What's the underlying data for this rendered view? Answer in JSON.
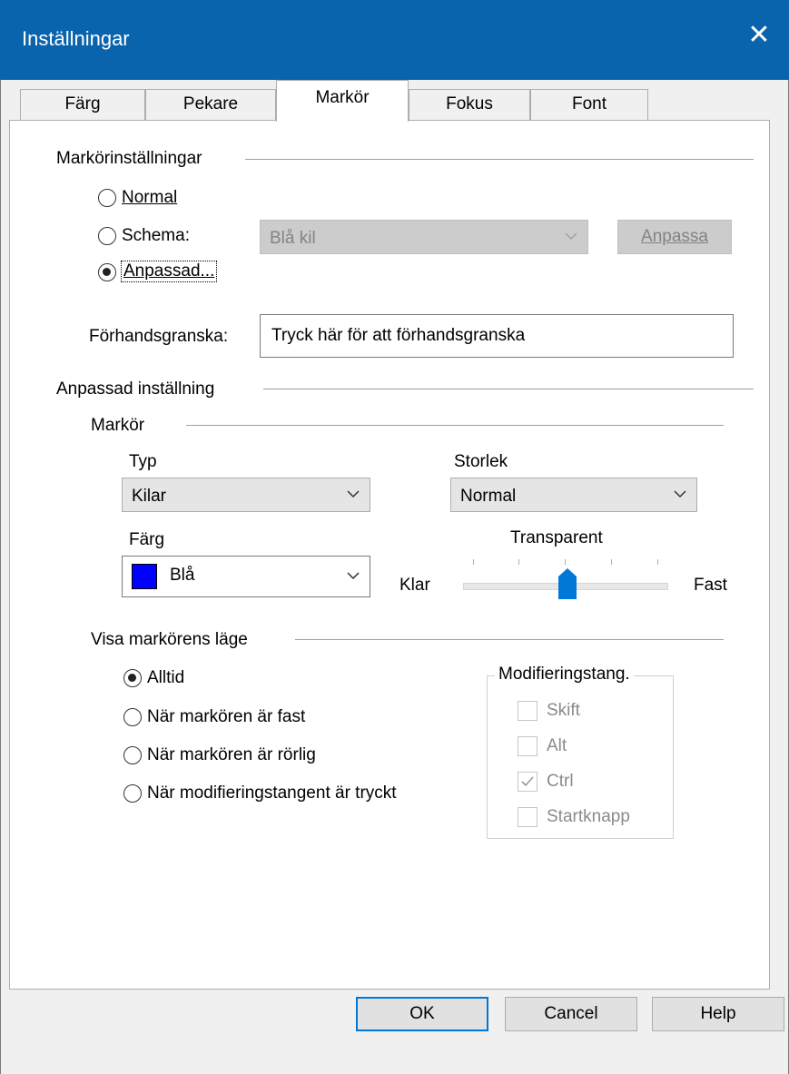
{
  "window": {
    "title": "Inställningar",
    "close_glyph": "✕",
    "titlebar_color": "#0a64ad"
  },
  "tabs": [
    {
      "label": "Färg",
      "active": false
    },
    {
      "label": "Pekare",
      "active": false
    },
    {
      "label": "Markör",
      "active": true
    },
    {
      "label": "Fokus",
      "active": false
    },
    {
      "label": "Font",
      "active": false
    }
  ],
  "cursor_settings": {
    "heading": "Markörinställningar",
    "options": [
      {
        "label": "Normal",
        "checked": false
      },
      {
        "label": "Schema:",
        "checked": false
      },
      {
        "label": "Anpassad...",
        "checked": true
      }
    ],
    "scheme_select": {
      "value": "Blå kil",
      "disabled": true
    },
    "customize_button": {
      "label": "Anpassa",
      "disabled": true
    }
  },
  "preview": {
    "label": "Förhandsgranska:",
    "value": "Tryck här för att förhandsgranska"
  },
  "custom_setting": {
    "heading": "Anpassad inställning",
    "cursor": {
      "heading": "Markör",
      "type": {
        "label": "Typ",
        "value": "Kilar"
      },
      "size": {
        "label": "Storlek",
        "value": "Normal"
      },
      "color": {
        "label": "Färg",
        "value": "Blå",
        "swatch_hex": "#0000ff"
      },
      "transparency": {
        "label": "Transparent",
        "min_label": "Klar",
        "max_label": "Fast",
        "level_fraction": 0.5
      }
    }
  },
  "show_position": {
    "heading": "Visa markörens läge",
    "options": [
      {
        "label": "Alltid",
        "checked": true
      },
      {
        "label": "När markören är fast",
        "checked": false
      },
      {
        "label": "När markören är rörlig",
        "checked": false
      },
      {
        "label": "När modifieringstangent är tryckt",
        "checked": false
      }
    ],
    "modifiers": {
      "heading": "Modifieringstang.",
      "items": [
        {
          "label": "Skift",
          "checked": false
        },
        {
          "label": "Alt",
          "checked": false
        },
        {
          "label": "Ctrl",
          "checked": true
        },
        {
          "label": "Startknapp",
          "checked": false
        }
      ]
    }
  },
  "footer": {
    "ok": "OK",
    "cancel": "Cancel",
    "help": "Help"
  },
  "colors": {
    "accent": "#0078d7",
    "slider_thumb": "#0078d7"
  }
}
